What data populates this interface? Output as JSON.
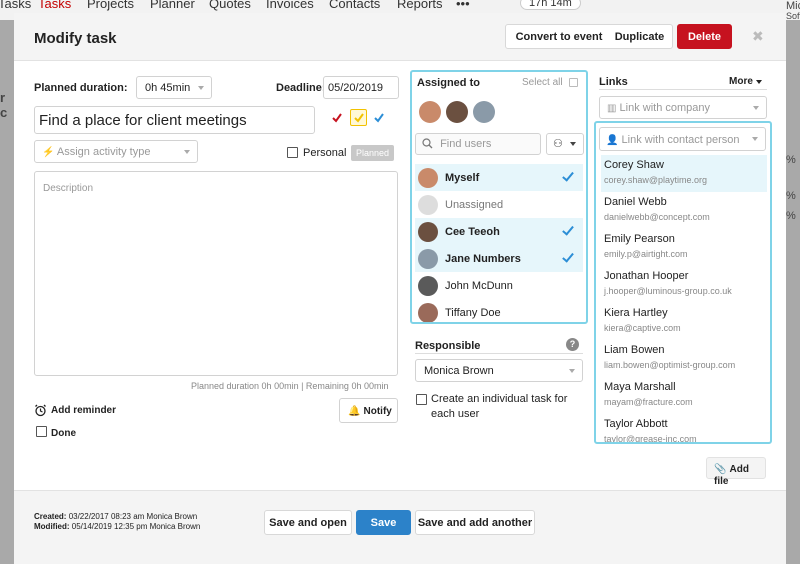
{
  "background_nav": {
    "items": [
      "Tasks",
      "Projects",
      "Planner",
      "Quotes",
      "Invoices",
      "Contacts",
      "Reports",
      "•••"
    ],
    "timer": "17h 14m"
  },
  "background_right": [
    "Mic",
    "Softv",
    "%",
    "%",
    "%"
  ],
  "background_left": [
    "r c"
  ],
  "header": {
    "title": "Modify task",
    "convert_label": "Convert to event",
    "duplicate_label": "Duplicate",
    "delete_label": "Delete",
    "close_glyph": "✖"
  },
  "form": {
    "planned_duration_label": "Planned duration:",
    "planned_duration_value": "0h 45min",
    "deadline_label": "Deadline:",
    "deadline_value": "05/20/2019",
    "task_title": "Find a place for client meetings",
    "activity_type_placeholder": "Assign activity type",
    "personal_label": "Personal",
    "planned_badge": "Planned",
    "description_placeholder": "Description",
    "duration_status": "Planned duration 0h 00min | Remaining 0h 00min",
    "add_reminder_label": "Add reminder",
    "notify_label": "Notify",
    "done_label": "Done",
    "flag_colors": [
      "#c6121f",
      "#f2c200",
      "#2c8ed6"
    ]
  },
  "assigned": {
    "title": "Assigned to",
    "select_all_label": "Select all",
    "search_placeholder": "Find users",
    "users": [
      {
        "name": "Myself",
        "selected": true,
        "avatar_color": "#c98a6a"
      },
      {
        "name": "Unassigned",
        "selected": false,
        "avatar_color": "#dddddd"
      },
      {
        "name": "Cee Teeoh",
        "selected": true,
        "avatar_color": "#6b5040"
      },
      {
        "name": "Jane Numbers",
        "selected": true,
        "avatar_color": "#8a9aa8"
      },
      {
        "name": "John McDunn",
        "selected": false,
        "avatar_color": "#5a5a5a"
      },
      {
        "name": "Tiffany Doe",
        "selected": false,
        "avatar_color": "#9a6a5a"
      }
    ]
  },
  "responsible": {
    "label": "Responsible",
    "help_glyph": "?",
    "value": "Monica Brown",
    "individual_task_label_line1": "Create an individual task for",
    "individual_task_label_line2": "each user"
  },
  "links": {
    "title": "Links",
    "more_label": "More",
    "company_placeholder": "Link with company",
    "contact_placeholder": "Link with contact person",
    "contacts": [
      {
        "name": "Corey Shaw",
        "email": "corey.shaw@playtime.org"
      },
      {
        "name": "Daniel Webb",
        "email": "danielwebb@concept.com"
      },
      {
        "name": "Emily Pearson",
        "email": "emily.p@airtight.com"
      },
      {
        "name": "Jonathan Hooper",
        "email": "j.hooper@luminous-group.co.uk"
      },
      {
        "name": "Kiera Hartley",
        "email": "kiera@captive.com"
      },
      {
        "name": "Liam Bowen",
        "email": "liam.bowen@optimist-group.com"
      },
      {
        "name": "Maya Marshall",
        "email": "mayam@fracture.com"
      },
      {
        "name": "Taylor Abbott",
        "email": "taylor@grease-inc.com"
      }
    ],
    "add_file_label": "Add file"
  },
  "footer": {
    "created_label": "Created:",
    "created_value": "03/22/2017 08:23 am Monica Brown",
    "modified_label": "Modified:",
    "modified_value": "05/14/2019 12:35 pm Monica Brown",
    "save_open_label": "Save and open",
    "save_label": "Save",
    "save_another_label": "Save and add another"
  }
}
